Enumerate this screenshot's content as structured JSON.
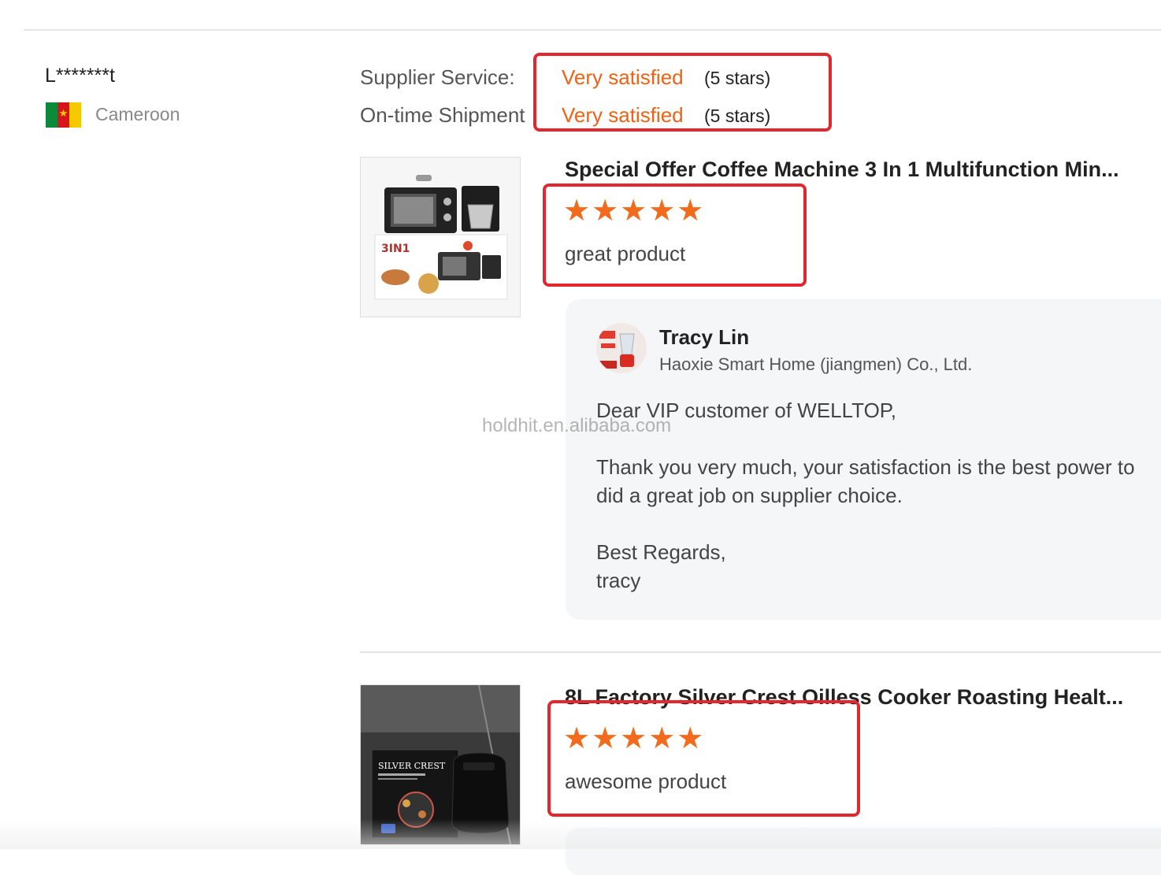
{
  "reviewer": {
    "name": "L*******t",
    "country": "Cameroon"
  },
  "ratings": [
    {
      "label": "Supplier Service:",
      "value": "Very satisfied",
      "stars": "(5 stars)"
    },
    {
      "label": "On-time Shipment",
      "value": "Very satisfied",
      "stars": "(5 stars)"
    }
  ],
  "reviews": [
    {
      "product_title": "Special Offer Coffee Machine 3 In 1 Multifunction Min...",
      "rating": 5,
      "stars_display": "★★★★★",
      "text": "great product",
      "thumb_text": "3IN1"
    },
    {
      "product_title": "8L Factory Silver Crest Oilless Cooker Roasting Healt...",
      "rating": 5,
      "stars_display": "★★★★★",
      "text": "awesome product",
      "thumb_text": "SILVER CREST"
    }
  ],
  "reply": {
    "name": "Tracy Lin",
    "company": "Haoxie Smart Home (jiangmen) Co., Ltd.",
    "lines": [
      "Dear VIP customer of WELLTOP,",
      "Thank you very much, your satisfaction is the best power to",
      "did a great job on supplier choice.",
      "Best Regards,",
      "tracy"
    ]
  },
  "watermark": "holdhit.en.alibaba.com",
  "colors": {
    "accent": "#ef6216",
    "star": "#f26a1b",
    "highlight_box": "#e0282e"
  }
}
